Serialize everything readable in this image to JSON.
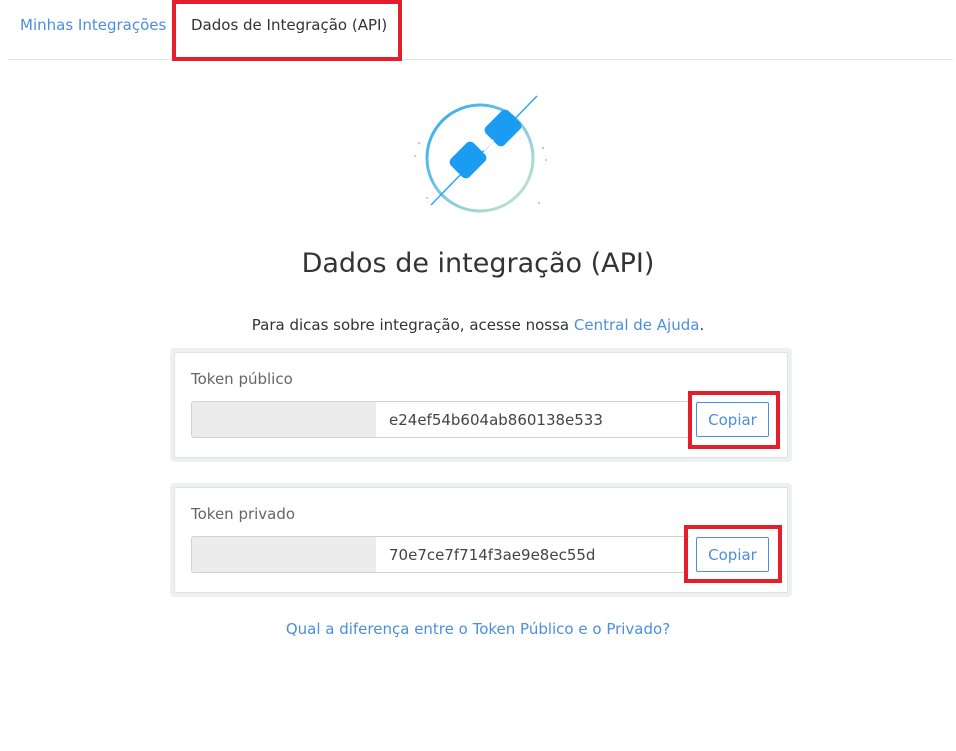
{
  "tabs": [
    {
      "label": "Minhas Integrações"
    },
    {
      "label": "Dados de Integração (API)"
    }
  ],
  "header": {
    "icon": "plug-icon",
    "title": "Dados de integração (API)"
  },
  "help": {
    "text": "Para dicas sobre integração, acesse nossa ",
    "link_text": "Central de Ajuda",
    "suffix": "."
  },
  "tokens": [
    {
      "label": "Token público",
      "value": "e24ef54b604ab860138e533",
      "button_label": "Copiar"
    },
    {
      "label": "Token privado",
      "value": "70e7ce7f714f3ae9e8ec55d",
      "button_label": "Copiar"
    }
  ],
  "footer": {
    "link_text": "Qual a diferença entre o Token Público e o Privado?"
  },
  "colors": {
    "accent": "#4a8fe0",
    "highlight": "#e41e2b",
    "text": "#333333"
  }
}
